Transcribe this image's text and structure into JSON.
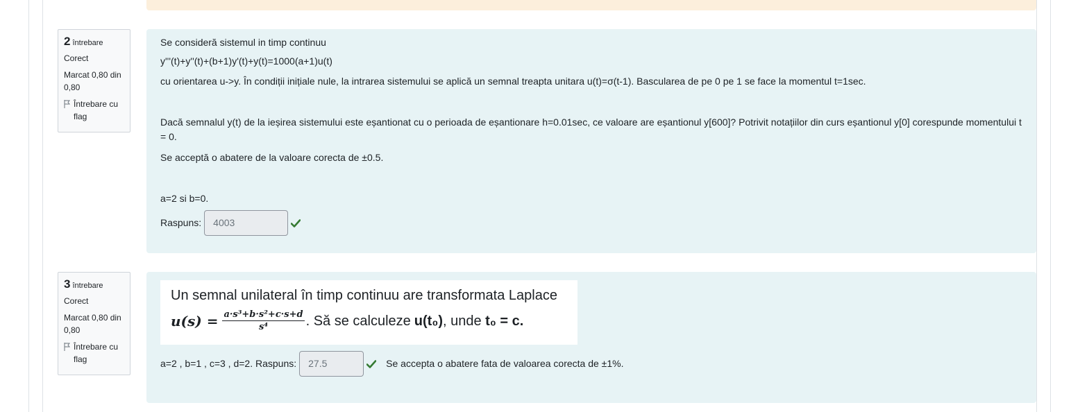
{
  "previous_feedback": {
    "color": "#fcefdc"
  },
  "q2": {
    "info": {
      "number": "2",
      "word": "întrebare",
      "state": "Corect",
      "grade": "Marcat 0,80 din 0,80",
      "flag_label": "Întrebare cu flag",
      "flag_icon": "flag-outline-icon"
    },
    "text": {
      "line1": "Se consideră sistemul in timp continuu",
      "line2": "y'''(t)+y''(t)+(b+1)y'(t)+y(t)=1000(a+1)u(t)",
      "line3": "cu orientarea u->y. În condiții inițiale nule, la intrarea sistemului se aplică un semnal treapta unitara u(t)=σ(t-1). Bascularea de pe 0 pe 1 se face la momentul t=1sec.",
      "line4": "Dacă semnalul y(t) de la ieșirea sistemului este eșantionat cu o perioada de eșantionare h=0.01sec, ce valoare are eșantionul y[600]?  Potrivit notațiilor din curs eșantionul y[0] corespunde momentului t = 0.",
      "line5": "Se acceptă o abatere de la valoare corecta de ±0.5.",
      "params": "a=2 si b=0.",
      "answer_label": "Raspuns:",
      "answer_value": "4003"
    }
  },
  "q3": {
    "info": {
      "number": "3",
      "word": "întrebare",
      "state": "Corect",
      "grade": "Marcat 0,80 din 0,80",
      "flag_label": "Întrebare cu flag",
      "flag_icon": "flag-outline-icon"
    },
    "image_text": {
      "line1": "Un semnal unilateral în timp continuu are transformata Laplace",
      "lhs": "u(s) =",
      "numerator": "a·s³+b·s²+c·s+d",
      "denominator": "s⁴",
      "rest_prefix": ". Să se calculeze ",
      "u_t0": "u(t₀)",
      "rest_mid": ", unde ",
      "t0_eq": "t₀ = c."
    },
    "text": {
      "params_label": "a=2 , b=1 , c=3 , d=2. Raspuns:",
      "answer_value": "27.5",
      "tolerance": "Se accepta o abatere fata de valoarea corecta de ±1%."
    }
  },
  "colors": {
    "content_bg": "#e7f3f5",
    "info_bg": "#f8f9fa",
    "correct_check": "#357a32"
  }
}
